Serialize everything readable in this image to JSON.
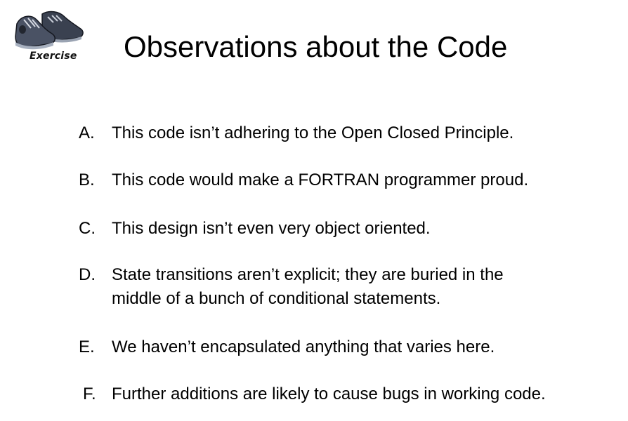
{
  "badge": {
    "label": "Exercise",
    "icon": "sneakers-icon"
  },
  "title": "Observations about the Code",
  "items": [
    {
      "letter": "A.",
      "text": "This code isn’t adhering to the Open Closed Principle."
    },
    {
      "letter": "B.",
      "text": "This code would make a FORTRAN programmer proud."
    },
    {
      "letter": "C.",
      "text": "This design isn’t even very object oriented."
    },
    {
      "letter": "D.",
      "text": "State transitions aren’t explicit; they are buried in the\nmiddle of a bunch of conditional statements."
    },
    {
      "letter": "E.",
      "text": "We haven’t encapsulated anything that varies here."
    },
    {
      "letter": "F.",
      "text": "Further additions are likely to cause bugs in working code."
    }
  ],
  "colors": {
    "background": "#ffffff",
    "text": "#000000"
  }
}
